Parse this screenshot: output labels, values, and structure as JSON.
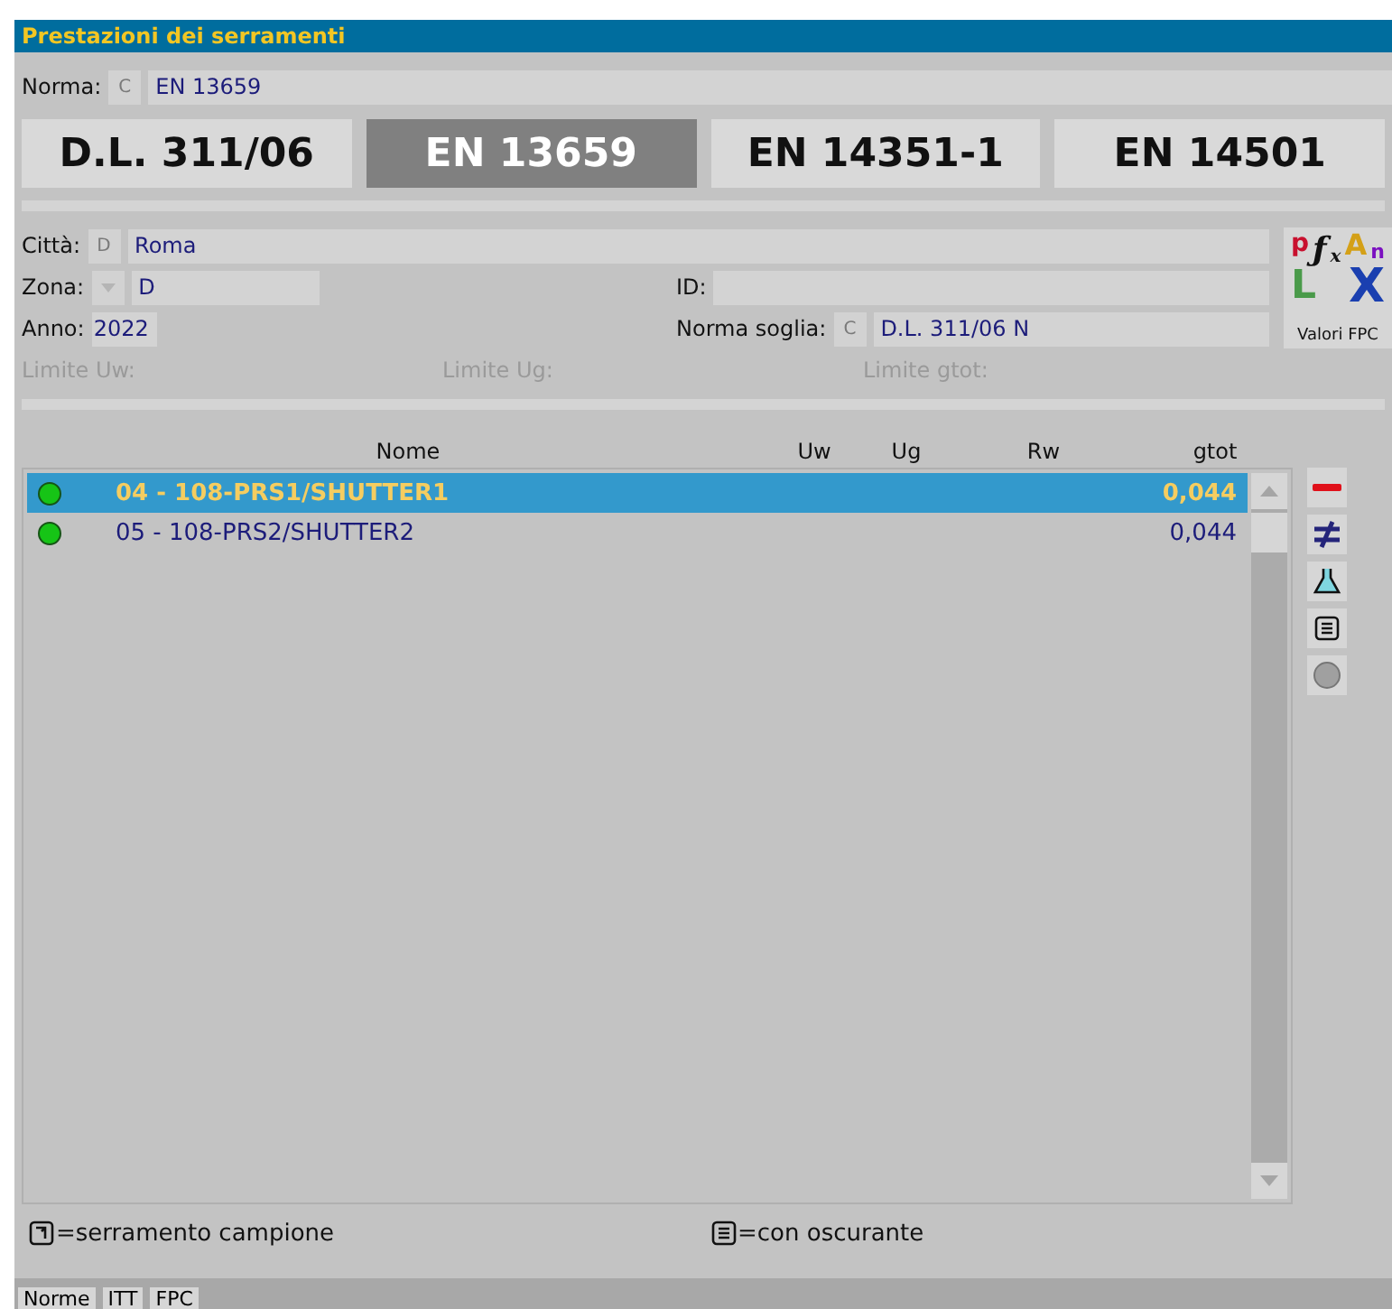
{
  "window": {
    "title": "Prestazioni dei serramenti"
  },
  "norma": {
    "label": "Norma:",
    "button": "C",
    "value": "EN 13659"
  },
  "norm_tabs": [
    {
      "label": "D.L. 311/06",
      "selected": false
    },
    {
      "label": "EN 13659",
      "selected": true
    },
    {
      "label": "EN 14351-1",
      "selected": false
    },
    {
      "label": "EN 14501",
      "selected": false
    }
  ],
  "info": {
    "citta": {
      "label": "Città:",
      "button": "D",
      "value": "Roma"
    },
    "zona": {
      "label": "Zona:",
      "value": "D"
    },
    "id": {
      "label": "ID:"
    },
    "anno": {
      "label": "Anno:",
      "value": "2022"
    },
    "norma_soglia": {
      "label": "Norma soglia:",
      "button": "C",
      "value": "D.L. 311/06 N"
    },
    "limits": [
      {
        "label": "Limite Uw:",
        "disabled": true
      },
      {
        "label": "Limite Ug:",
        "disabled": true
      },
      {
        "label": "Limite gtot:",
        "disabled": true
      }
    ]
  },
  "fpc_button": {
    "logo_letters": [
      "p",
      "ƒ",
      "x",
      "A",
      "n",
      "L",
      "X"
    ],
    "label": "Valori FPC"
  },
  "table": {
    "columns": [
      "Nome",
      "Uw",
      "Ug",
      "Rw",
      "gtot"
    ],
    "rows": [
      {
        "name": "04 - 108-PRS1/SHUTTER1",
        "gtot": "0,044",
        "selected": true,
        "color": "#16c416"
      },
      {
        "name": "05 - 108-PRS2/SHUTTER2",
        "gtot": "0,044",
        "selected": false,
        "color": "#16c416"
      }
    ]
  },
  "legend": [
    {
      "kind": "campione",
      "text": "=serramento campione"
    },
    {
      "kind": "oscurante",
      "text": "=con oscurante"
    }
  ],
  "bottom_tabs": [
    {
      "label": "Norme"
    },
    {
      "label": "ITT"
    },
    {
      "label": "FPC"
    }
  ]
}
